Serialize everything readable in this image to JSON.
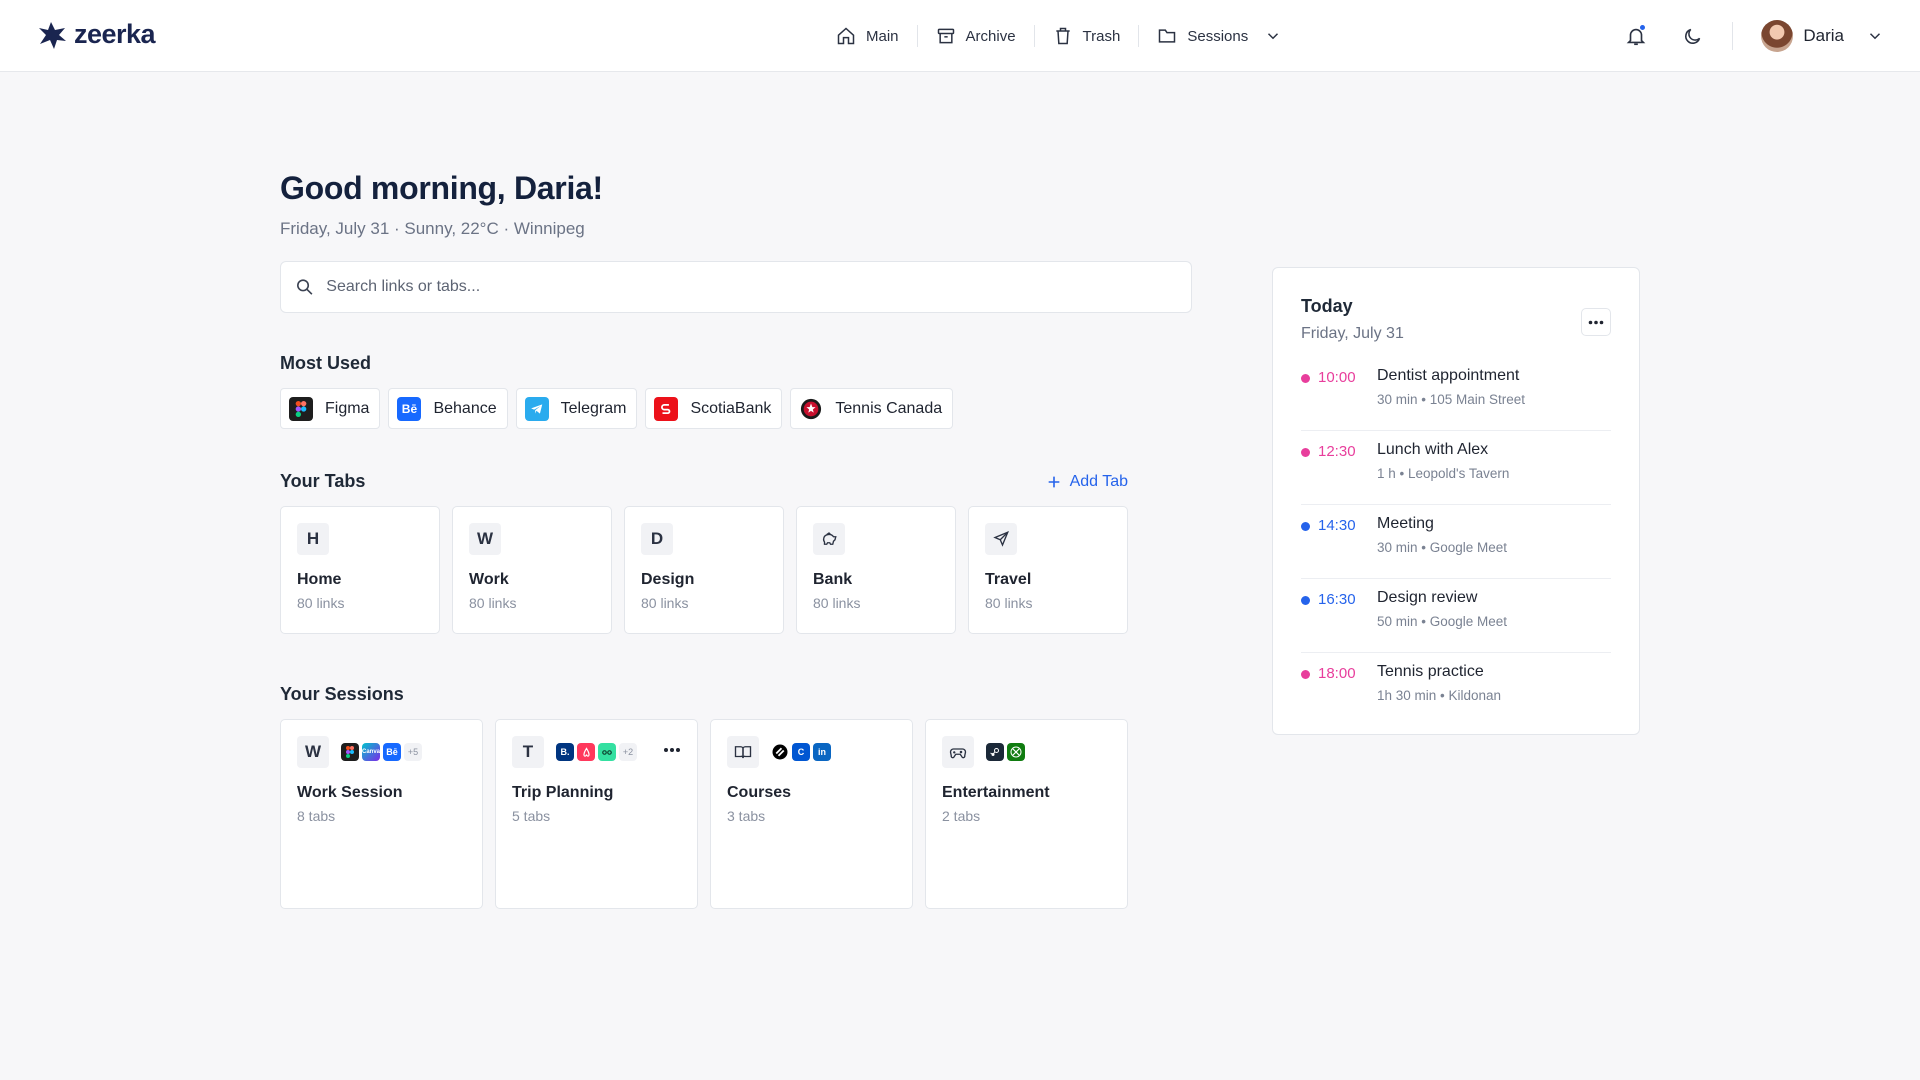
{
  "brand": {
    "name": "zeerka"
  },
  "nav": {
    "items": [
      {
        "label": "Main",
        "icon": "home-icon"
      },
      {
        "label": "Archive",
        "icon": "archive-icon"
      },
      {
        "label": "Trash",
        "icon": "trash-icon"
      },
      {
        "label": "Sessions",
        "icon": "folder-icon"
      }
    ]
  },
  "user": {
    "name": "Daria"
  },
  "greeting": {
    "title": "Good morning, Daria!",
    "subtitle": "Friday, July 31 · Sunny, 22°C · Winnipeg"
  },
  "search": {
    "placeholder": "Search links or tabs..."
  },
  "most_used": {
    "title": "Most Used",
    "items": [
      {
        "label": "Figma",
        "color": "#1e1e1e"
      },
      {
        "label": "Behance",
        "color": "#1769ff"
      },
      {
        "label": "Telegram",
        "color": "#2aabee"
      },
      {
        "label": "ScotiaBank",
        "color": "#ec111a"
      },
      {
        "label": "Tennis Canada",
        "color": "#c8102e"
      }
    ]
  },
  "tabs": {
    "title": "Your Tabs",
    "add_label": "Add Tab",
    "items": [
      {
        "letter": "H",
        "name": "Home",
        "count": "80 links"
      },
      {
        "letter": "W",
        "name": "Work",
        "count": "80 links"
      },
      {
        "letter": "D",
        "name": "Design",
        "count": "80 links"
      },
      {
        "letter": "",
        "icon": "piggy-bank-icon",
        "name": "Bank",
        "count": "80 links"
      },
      {
        "letter": "",
        "icon": "plane-icon",
        "name": "Travel",
        "count": "80 links"
      }
    ]
  },
  "sessions": {
    "title": "Your Sessions",
    "items": [
      {
        "letter": "W",
        "name": "Work Session",
        "count": "8 tabs",
        "more": "+5"
      },
      {
        "letter": "T",
        "name": "Trip Planning",
        "count": "5 tabs",
        "more": "+2"
      },
      {
        "letter": "",
        "icon": "book-icon",
        "name": "Courses",
        "count": "3 tabs",
        "more": ""
      },
      {
        "letter": "",
        "icon": "gamepad-icon",
        "name": "Entertainment",
        "count": "2 tabs",
        "more": ""
      }
    ]
  },
  "today": {
    "title": "Today",
    "date": "Friday, July 31",
    "events": [
      {
        "time": "10:00",
        "title": "Dentist appointment",
        "details": "30 min • 105 Main Street",
        "color": "#e83e9c"
      },
      {
        "time": "12:30",
        "title": "Lunch with Alex",
        "details": "1 h • Leopold's Tavern",
        "color": "#e83e9c"
      },
      {
        "time": "14:30",
        "title": "Meeting",
        "details": "30 min • Google Meet",
        "color": "#2563eb"
      },
      {
        "time": "16:30",
        "title": "Design review",
        "details": "50 min • Google Meet",
        "color": "#2563eb"
      },
      {
        "time": "18:00",
        "title": "Tennis practice",
        "details": "1h 30 min • Kildonan",
        "color": "#e83e9c"
      }
    ]
  }
}
